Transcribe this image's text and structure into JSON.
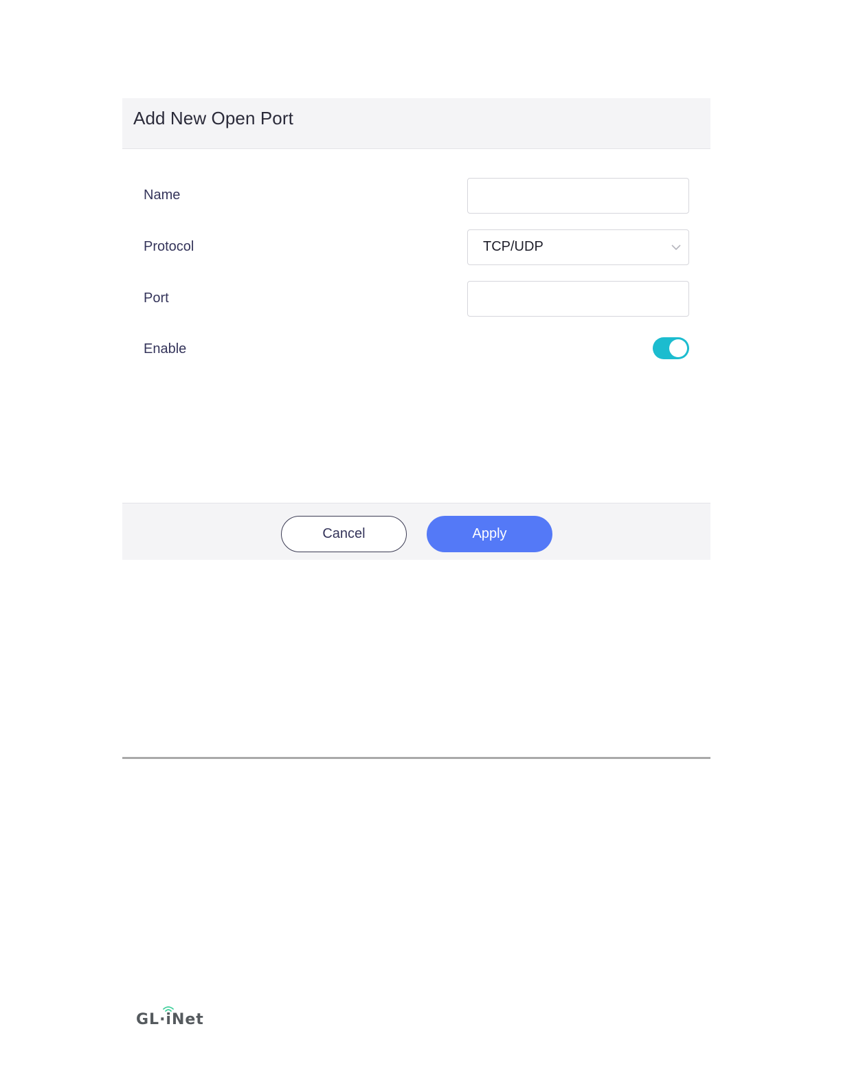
{
  "dialog": {
    "title": "Add New Open Port",
    "fields": {
      "name": {
        "label": "Name",
        "value": ""
      },
      "protocol": {
        "label": "Protocol",
        "value": "TCP/UDP"
      },
      "port": {
        "label": "Port",
        "value": ""
      },
      "enable": {
        "label": "Enable",
        "checked": true
      }
    },
    "buttons": {
      "cancel": "Cancel",
      "apply": "Apply"
    }
  },
  "logo": {
    "text": "GL·iNet"
  },
  "colors": {
    "accent_button": "#5479f7",
    "toggle_on": "#1cbccf",
    "logo_wifi": "#3fcf9b"
  },
  "icons": {
    "dropdown": "chevron-down-icon",
    "logo": "wifi-icon"
  }
}
